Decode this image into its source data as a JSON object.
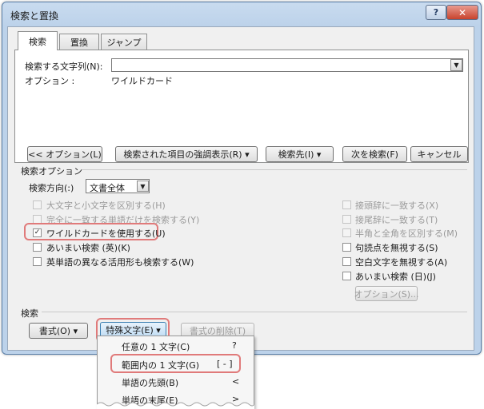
{
  "dialog": {
    "title": "検索と置換",
    "help_glyph": "?",
    "close_glyph": "✕"
  },
  "tabs": [
    {
      "label": "検索"
    },
    {
      "label": "置換"
    },
    {
      "label": "ジャンプ"
    }
  ],
  "find": {
    "label": "検索する文字列(N):",
    "value": "",
    "options_label": "オプション :",
    "options_value": "ワイルドカード"
  },
  "buttons": {
    "less_options": "<< オプション(L)",
    "highlight": "検索された項目の強調表示(R) ▾",
    "find_in": "検索先(I) ▾",
    "find_next": "次を検索(F)",
    "cancel": "キャンセル"
  },
  "search_options": {
    "heading": "検索オプション",
    "direction_label": "検索方向(:)",
    "direction_value": "文書全体",
    "left": [
      {
        "label": "大文字と小文字を区別する(H)",
        "checked": false,
        "disabled": true
      },
      {
        "label": "完全に一致する単語だけを検索する(Y)",
        "checked": false,
        "disabled": true
      },
      {
        "label": "ワイルドカードを使用する(U)",
        "checked": true,
        "disabled": false
      },
      {
        "label": "あいまい検索 (英)(K)",
        "checked": false,
        "disabled": false
      },
      {
        "label": "英単語の異なる活用形も検索する(W)",
        "checked": false,
        "disabled": false
      }
    ],
    "right": [
      {
        "label": "接頭辞に一致する(X)",
        "checked": false,
        "disabled": true
      },
      {
        "label": "接尾辞に一致する(T)",
        "checked": false,
        "disabled": true
      },
      {
        "label": "半角と全角を区別する(M)",
        "checked": false,
        "disabled": true
      },
      {
        "label": "句読点を無視する(S)",
        "checked": false,
        "disabled": false
      },
      {
        "label": "空白文字を無視する(A)",
        "checked": false,
        "disabled": false
      },
      {
        "label": "あいまい検索 (日)(J)",
        "checked": false,
        "disabled": false
      }
    ],
    "fuzzy_options_button": "オプション(S)..."
  },
  "search_section": {
    "heading": "検索",
    "format_button": "書式(O) ▾",
    "special_button": "特殊文字(E) ▾",
    "clear_format_button": "書式の削除(T)"
  },
  "special_menu": [
    {
      "label": "任意の 1 文字(C)",
      "code": "?"
    },
    {
      "label": "範囲内の 1 文字(G)",
      "code": "[ - ]"
    },
    {
      "label": "単語の先頭(B)",
      "code": "<"
    },
    {
      "label": "単語の末尾(E)",
      "code": ">"
    }
  ],
  "colors": {
    "highlight_outline": "#e07a7a",
    "dialog_frame": "#bcd2ea",
    "close_button": "#c8432d"
  }
}
